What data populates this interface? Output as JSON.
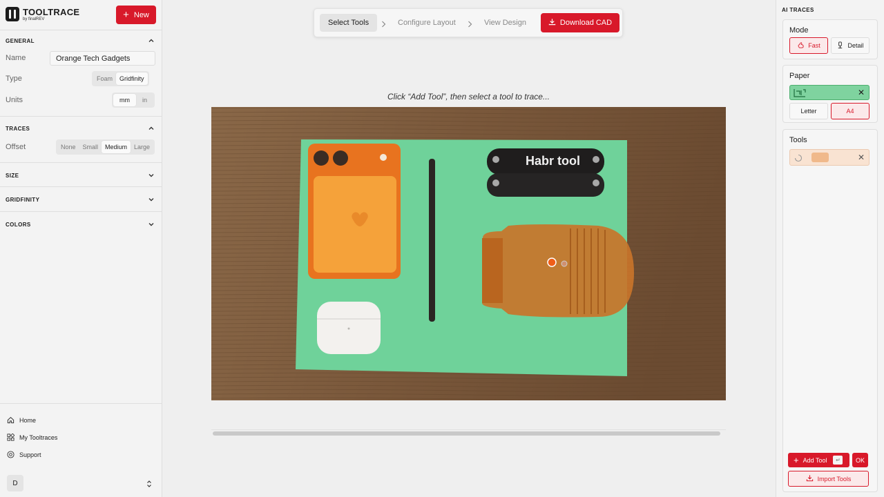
{
  "sidebar": {
    "brand_name": "TOOLTRACE",
    "brand_sub": "by finalREV",
    "new_label": "New",
    "general": {
      "title": "GENERAL",
      "name_label": "Name",
      "name_value": "Orange Tech Gadgets",
      "type_label": "Type",
      "type_options": [
        "Foam",
        "Gridfinity"
      ],
      "type_selected": "Gridfinity",
      "units_label": "Units",
      "units_options": [
        "mm",
        "in"
      ],
      "units_selected": "mm"
    },
    "traces": {
      "title": "TRACES",
      "offset_label": "Offset",
      "offset_options": [
        "None",
        "Small",
        "Medium",
        "Large"
      ],
      "offset_selected": "Medium"
    },
    "size_title": "SIZE",
    "gridfinity_title": "GRIDFINITY",
    "colors_title": "COLORS",
    "nav": {
      "home": "Home",
      "my_tooltraces": "My Tooltraces",
      "support": "Support"
    },
    "user_initial": "D"
  },
  "stepper": {
    "steps": [
      "Select Tools",
      "Configure Layout",
      "View Design"
    ],
    "active_step": "Select Tools",
    "download_label": "Download CAD"
  },
  "canvas": {
    "instruction": "Click “Add Tool”, then select a tool to trace...",
    "multitool_brand": "Habr tool"
  },
  "right_panel": {
    "title": "AI TRACES",
    "mode": {
      "title": "Mode",
      "options": [
        "Fast",
        "Detail"
      ],
      "selected": "Fast"
    },
    "paper": {
      "title": "Paper",
      "swatch_color": "#7fd39f",
      "options": [
        "Letter",
        "A4"
      ],
      "selected": "A4"
    },
    "tools": {
      "title": "Tools",
      "swatch_color": "#f0b98b"
    },
    "add_tool_label": "Add Tool",
    "ok_label": "OK",
    "import_label": "Import Tools"
  },
  "colors": {
    "accent": "#d8192a",
    "paper_green": "#7fd39f",
    "trace_orange": "#c8742a"
  }
}
